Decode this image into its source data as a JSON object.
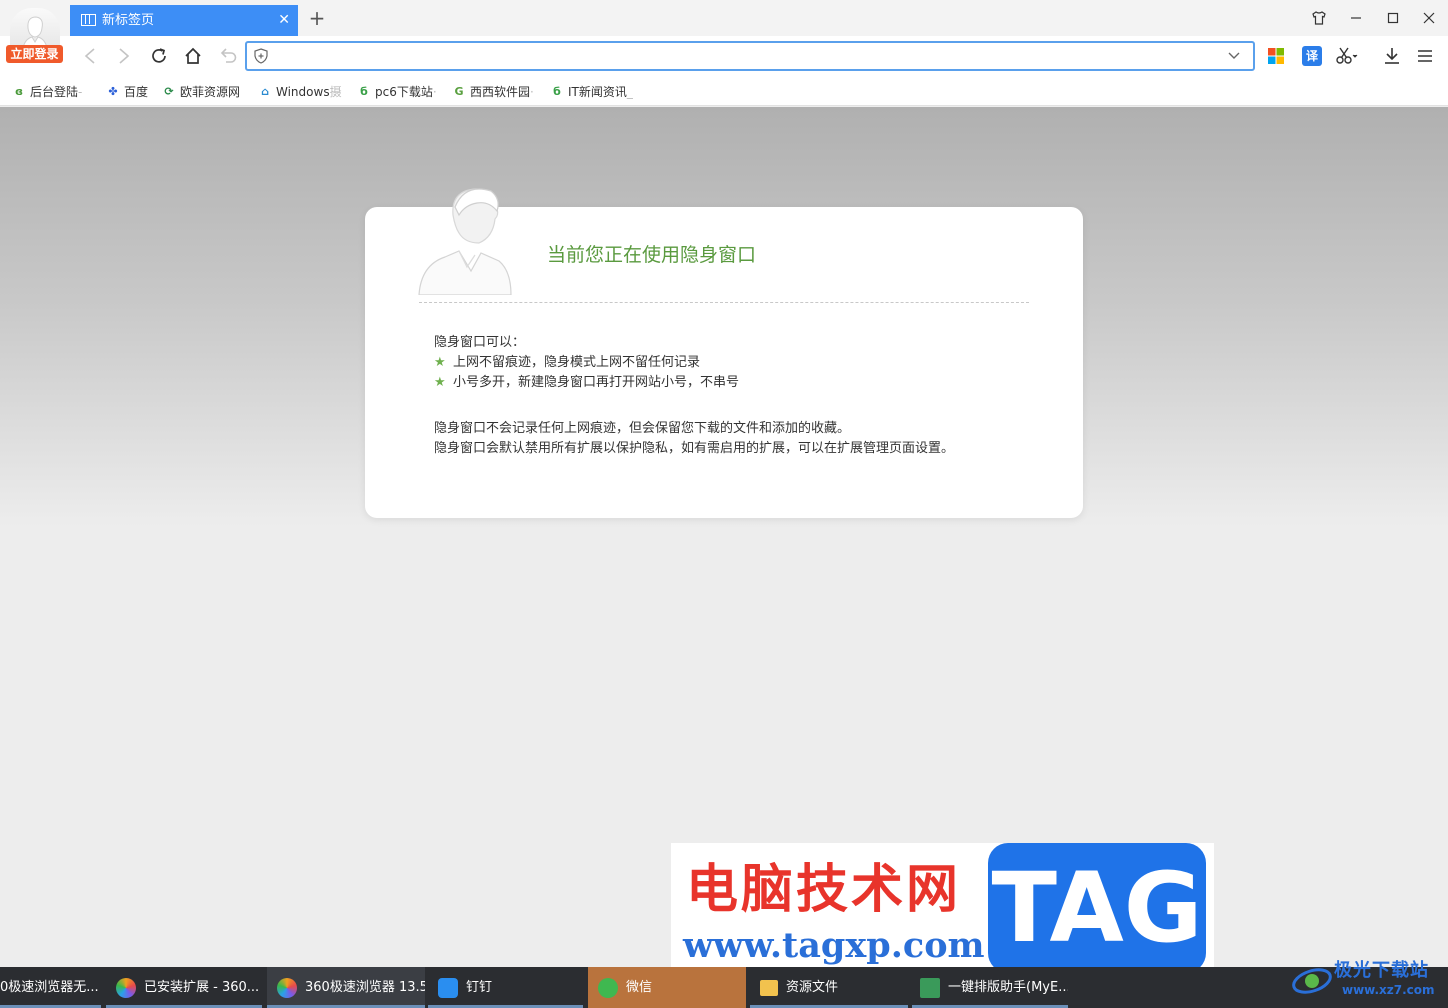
{
  "browser": {
    "login_badge": "立即登录",
    "tab": {
      "title": "新标签页"
    },
    "address": {
      "value": "",
      "placeholder": ""
    },
    "toolbar": {
      "translate_label": "译"
    }
  },
  "bookmarks": [
    {
      "label": "后台登陆",
      "suffix": "-",
      "icon": "globe-swirl-icon",
      "color": "#4a9a3a"
    },
    {
      "label": "百度",
      "suffix": "",
      "icon": "baidu-paw-icon",
      "color": "#2a5fd8"
    },
    {
      "label": "欧菲资源网",
      "suffix": "",
      "icon": "refresh-circle-icon",
      "color": "#2b8a4a"
    },
    {
      "label": "Windows",
      "suffix": "摄",
      "icon": "windows-cap-icon",
      "color": "#2a8ad0"
    },
    {
      "label": "pc6下载站",
      "suffix": "·",
      "icon": "pc6-icon",
      "color": "#3aa048"
    },
    {
      "label": "西西软件园",
      "suffix": "·",
      "icon": "cc-icon",
      "color": "#5aa040"
    },
    {
      "label": "IT新闻资讯",
      "suffix": "_",
      "icon": "pc6-icon",
      "color": "#3aa048"
    }
  ],
  "incognito": {
    "title": "当前您正在使用隐身窗口",
    "can_label": "隐身窗口可以：",
    "features": [
      "上网不留痕迹，隐身模式上网不留任何记录",
      "小号多开，新建隐身窗口再打开网站小号，不串号"
    ],
    "notes": [
      "隐身窗口不会记录任何上网痕迹，但会保留您下载的文件和添加的收藏。",
      "隐身窗口会默认禁用所有扩展以保护隐私，如有需启用的扩展，可以在扩展管理页面设置。"
    ]
  },
  "watermark": {
    "title": "电脑技术网",
    "url": "www.tagxp.com",
    "tag": "TAG",
    "corner_title": "极光下载站",
    "corner_url": "www.xz7.com"
  },
  "taskbar": [
    {
      "label": "0极速浏览器无...",
      "icon": "browser-360-icon",
      "color": "#5a9ad8",
      "active": false
    },
    {
      "label": "已安装扩展 - 360...",
      "icon": "browser-360-icon",
      "color": "#f0a020",
      "active": false
    },
    {
      "label": "360极速浏览器 13.5",
      "icon": "browser-360-icon",
      "color": "#f0a020",
      "active": true
    },
    {
      "label": "钉钉",
      "icon": "dingtalk-icon",
      "color": "#2a8ef0",
      "active": false
    },
    {
      "label": "微信",
      "icon": "wechat-icon",
      "color": "#3fb850",
      "active": false
    },
    {
      "label": "资源文件",
      "icon": "folder-icon",
      "color": "#f2c24e",
      "active": false
    },
    {
      "label": "一键排版助手(MyE...",
      "icon": "myeditor-icon",
      "color": "#3a9a5a",
      "active": false
    }
  ]
}
